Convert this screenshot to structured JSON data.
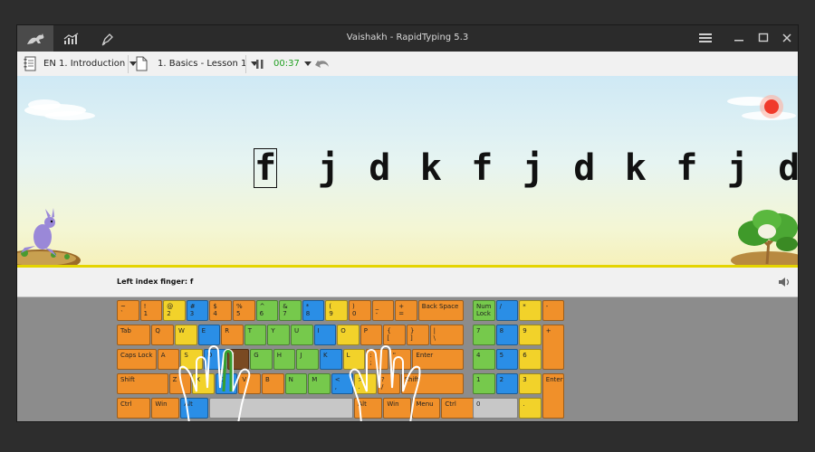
{
  "window": {
    "title": "Vaishakh - RapidTyping 5.3"
  },
  "toolbar": {
    "course": "EN 1. Introduction",
    "lesson": "1. Basics - Lesson 1",
    "timer": "00:37"
  },
  "exercise": {
    "letters": [
      "f",
      "j",
      "d",
      "k",
      "f",
      "j",
      "d",
      "k",
      "f",
      "j",
      "d"
    ]
  },
  "status": {
    "finger_hint": "Left index finger: f"
  },
  "colors": {
    "orange": "#f0902a",
    "yellow": "#f2d22a",
    "green": "#76c94c",
    "blue": "#2a8ee6",
    "timer": "#22a022"
  },
  "keyboard": {
    "main": [
      {
        "row": 0,
        "keys": [
          {
            "l": "~\n`",
            "c": "o"
          },
          {
            "l": "!\n1",
            "c": "o"
          },
          {
            "l": "@\n2",
            "c": "y"
          },
          {
            "l": "#\n3",
            "c": "b"
          },
          {
            "l": "$\n4",
            "c": "o"
          },
          {
            "l": "%\n5",
            "c": "o"
          },
          {
            "l": "^\n6",
            "c": "g"
          },
          {
            "l": "&\n7",
            "c": "g"
          },
          {
            "l": "*\n8",
            "c": "b"
          },
          {
            "l": "(\n9",
            "c": "y"
          },
          {
            "l": ")\n0",
            "c": "o"
          },
          {
            "l": "_\n-",
            "c": "o"
          },
          {
            "l": "+\n=",
            "c": "o"
          },
          {
            "l": "Back Space",
            "c": "o",
            "w": 2
          }
        ]
      },
      {
        "row": 1,
        "keys": [
          {
            "l": "Tab",
            "c": "o",
            "w": 1.5
          },
          {
            "l": "Q",
            "c": "o"
          },
          {
            "l": "W",
            "c": "y"
          },
          {
            "l": "E",
            "c": "b"
          },
          {
            "l": "R",
            "c": "o"
          },
          {
            "l": "T",
            "c": "g"
          },
          {
            "l": "Y",
            "c": "g"
          },
          {
            "l": "U",
            "c": "g"
          },
          {
            "l": "I",
            "c": "b"
          },
          {
            "l": "O",
            "c": "y"
          },
          {
            "l": "P",
            "c": "o"
          },
          {
            "l": "{\n[",
            "c": "o"
          },
          {
            "l": "}\n]",
            "c": "o"
          },
          {
            "l": "|\n\\",
            "c": "o",
            "w": 1.5
          }
        ]
      },
      {
        "row": 2,
        "keys": [
          {
            "l": "Caps Lock",
            "c": "o",
            "w": 1.75
          },
          {
            "l": "A",
            "c": "o"
          },
          {
            "l": "S",
            "c": "y"
          },
          {
            "l": "D",
            "c": "b"
          },
          {
            "l": "F",
            "c": "br"
          },
          {
            "l": "G",
            "c": "g"
          },
          {
            "l": "H",
            "c": "g"
          },
          {
            "l": "J",
            "c": "g"
          },
          {
            "l": "K",
            "c": "b"
          },
          {
            "l": "L",
            "c": "y"
          },
          {
            "l": ":\n;",
            "c": "o"
          },
          {
            "l": "\"\n'",
            "c": "o"
          },
          {
            "l": "Enter",
            "c": "o",
            "w": 2.25
          }
        ]
      },
      {
        "row": 3,
        "keys": [
          {
            "l": "Shift",
            "c": "o",
            "w": 2.25
          },
          {
            "l": "Z",
            "c": "o"
          },
          {
            "l": "X",
            "c": "y"
          },
          {
            "l": "C",
            "c": "b"
          },
          {
            "l": "V",
            "c": "o"
          },
          {
            "l": "B",
            "c": "o"
          },
          {
            "l": "N",
            "c": "g"
          },
          {
            "l": "M",
            "c": "g"
          },
          {
            "l": "<\n,",
            "c": "b"
          },
          {
            "l": ">\n.",
            "c": "y"
          },
          {
            "l": "?\n/",
            "c": "o"
          },
          {
            "l": "Shift",
            "c": "o",
            "w": 2.75
          }
        ]
      },
      {
        "row": 4,
        "keys": [
          {
            "l": "Ctrl",
            "c": "o",
            "w": 1.5
          },
          {
            "l": "Win",
            "c": "o",
            "w": 1.25
          },
          {
            "l": "Alt",
            "c": "b",
            "w": 1.25
          },
          {
            "l": "",
            "c": "gr",
            "w": 6.25
          },
          {
            "l": "Alt",
            "c": "o",
            "w": 1.25
          },
          {
            "l": "Win",
            "c": "o",
            "w": 1.25
          },
          {
            "l": "Menu",
            "c": "o",
            "w": 1.25
          },
          {
            "l": "Ctrl",
            "c": "o",
            "w": 1.5
          }
        ]
      }
    ],
    "numpad": [
      {
        "l": "Num\nLock",
        "c": "g",
        "x": 0,
        "y": 0
      },
      {
        "l": "/",
        "c": "b",
        "x": 1,
        "y": 0
      },
      {
        "l": "*",
        "c": "y",
        "x": 2,
        "y": 0
      },
      {
        "l": "-",
        "c": "o",
        "x": 3,
        "y": 0
      },
      {
        "l": "7",
        "c": "g",
        "x": 0,
        "y": 1
      },
      {
        "l": "8",
        "c": "b",
        "x": 1,
        "y": 1
      },
      {
        "l": "9",
        "c": "y",
        "x": 2,
        "y": 1
      },
      {
        "l": "+",
        "c": "o",
        "x": 3,
        "y": 1,
        "h": 2
      },
      {
        "l": "4",
        "c": "g",
        "x": 0,
        "y": 2
      },
      {
        "l": "5",
        "c": "b",
        "x": 1,
        "y": 2
      },
      {
        "l": "6",
        "c": "y",
        "x": 2,
        "y": 2
      },
      {
        "l": "1",
        "c": "g",
        "x": 0,
        "y": 3
      },
      {
        "l": "2",
        "c": "b",
        "x": 1,
        "y": 3
      },
      {
        "l": "3",
        "c": "y",
        "x": 2,
        "y": 3
      },
      {
        "l": "Enter",
        "c": "o",
        "x": 3,
        "y": 3,
        "h": 2
      },
      {
        "l": "0",
        "c": "gr",
        "x": 0,
        "y": 4,
        "w": 2
      },
      {
        "l": ".",
        "c": "y",
        "x": 2,
        "y": 4
      }
    ]
  }
}
